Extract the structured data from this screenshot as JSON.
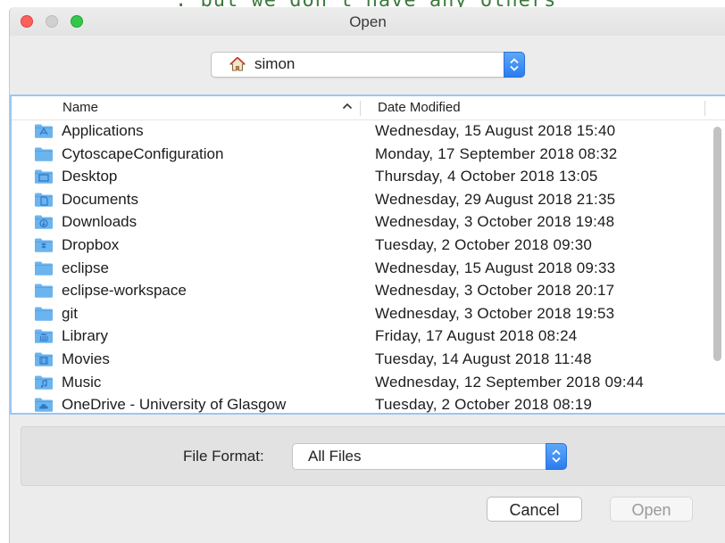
{
  "window": {
    "title": "Open"
  },
  "location": {
    "selected": "simon",
    "icon": "home-icon"
  },
  "columns": {
    "name": "Name",
    "date": "Date Modified",
    "sort_icon": "chevron-up-icon"
  },
  "files": [
    {
      "name": "Applications",
      "date": "Wednesday, 15 August 2018 15:40",
      "icon": "applications-folder-icon"
    },
    {
      "name": "CytoscapeConfiguration",
      "date": "Monday, 17 September 2018 08:32",
      "icon": "folder-icon"
    },
    {
      "name": "Desktop",
      "date": "Thursday, 4 October 2018 13:05",
      "icon": "desktop-folder-icon"
    },
    {
      "name": "Documents",
      "date": "Wednesday, 29 August 2018 21:35",
      "icon": "documents-folder-icon"
    },
    {
      "name": "Downloads",
      "date": "Wednesday, 3 October 2018 19:48",
      "icon": "downloads-folder-icon"
    },
    {
      "name": "Dropbox",
      "date": "Tuesday, 2 October 2018 09:30",
      "icon": "dropbox-folder-icon"
    },
    {
      "name": "eclipse",
      "date": "Wednesday, 15 August 2018 09:33",
      "icon": "folder-icon"
    },
    {
      "name": "eclipse-workspace",
      "date": "Wednesday, 3 October 2018 20:17",
      "icon": "folder-icon"
    },
    {
      "name": "git",
      "date": "Wednesday, 3 October 2018 19:53",
      "icon": "folder-icon"
    },
    {
      "name": "Library",
      "date": "Friday, 17 August 2018 08:24",
      "icon": "library-folder-icon"
    },
    {
      "name": "Movies",
      "date": "Tuesday, 14 August 2018 11:48",
      "icon": "movies-folder-icon"
    },
    {
      "name": "Music",
      "date": "Wednesday, 12 September 2018 09:44",
      "icon": "music-folder-icon"
    },
    {
      "name": "OneDrive - University of Glasgow",
      "date": "Tuesday, 2 October 2018 08:19",
      "icon": "onedrive-folder-icon"
    }
  ],
  "format": {
    "label": "File Format:",
    "selected": "All Files"
  },
  "buttons": {
    "cancel": "Cancel",
    "open": "Open"
  },
  "background_text": ". but we don't have any others",
  "colors": {
    "accent": "#2a7cf0",
    "folder": "#6cb4ee",
    "close": "#fc605b",
    "zoom": "#34c84a"
  }
}
